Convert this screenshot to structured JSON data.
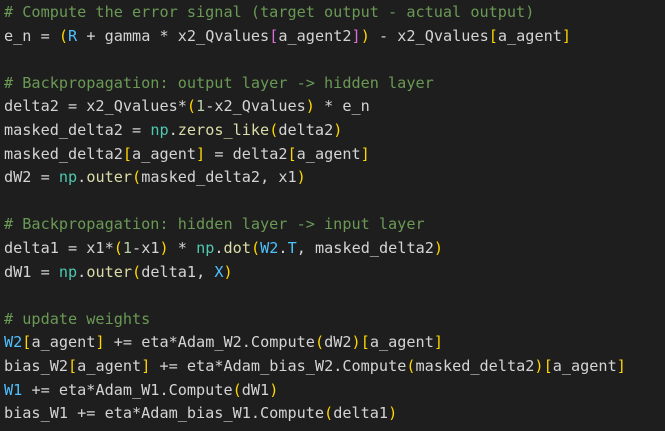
{
  "editor": {
    "lines": [
      [
        [
          "comment",
          "# Compute the error signal (target output - actual output)"
        ]
      ],
      [
        [
          "plain",
          "e_n = "
        ],
        [
          "paren",
          "("
        ],
        [
          "const",
          "R"
        ],
        [
          "plain",
          " + gamma * x2_Qvalues"
        ],
        [
          "bracket-p",
          "["
        ],
        [
          "plain",
          "a_agent2"
        ],
        [
          "bracket-p",
          "]"
        ],
        [
          "paren",
          ")"
        ],
        [
          "plain",
          " - x2_Qvalues"
        ],
        [
          "bracket-y",
          "["
        ],
        [
          "plain",
          "a_agent"
        ],
        [
          "bracket-y",
          "]"
        ]
      ],
      [],
      [
        [
          "comment",
          "# Backpropagation: output layer -> hidden layer"
        ]
      ],
      [
        [
          "plain",
          "delta2 = x2_Qvalues*"
        ],
        [
          "paren",
          "("
        ],
        [
          "num",
          "1"
        ],
        [
          "plain",
          "-x2_Qvalues"
        ],
        [
          "paren",
          ")"
        ],
        [
          "plain",
          " * e_n"
        ]
      ],
      [
        [
          "plain",
          "masked_delta2 = "
        ],
        [
          "class",
          "np"
        ],
        [
          "plain",
          "."
        ],
        [
          "func",
          "zeros_like"
        ],
        [
          "paren",
          "("
        ],
        [
          "plain",
          "delta2"
        ],
        [
          "paren",
          ")"
        ]
      ],
      [
        [
          "plain",
          "masked_delta2"
        ],
        [
          "bracket-y",
          "["
        ],
        [
          "plain",
          "a_agent"
        ],
        [
          "bracket-y",
          "]"
        ],
        [
          "plain",
          " = delta2"
        ],
        [
          "bracket-y",
          "["
        ],
        [
          "plain",
          "a_agent"
        ],
        [
          "bracket-y",
          "]"
        ]
      ],
      [
        [
          "plain",
          "dW2 = "
        ],
        [
          "class",
          "np"
        ],
        [
          "plain",
          "."
        ],
        [
          "func",
          "outer"
        ],
        [
          "paren",
          "("
        ],
        [
          "plain",
          "masked_delta2, x1"
        ],
        [
          "paren",
          ")"
        ]
      ],
      [],
      [
        [
          "comment",
          "# Backpropagation: hidden layer -> input layer"
        ]
      ],
      [
        [
          "plain",
          "delta1 = x1*"
        ],
        [
          "paren",
          "("
        ],
        [
          "num",
          "1"
        ],
        [
          "plain",
          "-x1"
        ],
        [
          "paren",
          ")"
        ],
        [
          "plain",
          " * "
        ],
        [
          "class",
          "np"
        ],
        [
          "plain",
          "."
        ],
        [
          "func",
          "dot"
        ],
        [
          "paren",
          "("
        ],
        [
          "const",
          "W2"
        ],
        [
          "plain",
          "."
        ],
        [
          "const",
          "T"
        ],
        [
          "plain",
          ", masked_delta2"
        ],
        [
          "paren",
          ")"
        ]
      ],
      [
        [
          "plain",
          "dW1 = "
        ],
        [
          "class",
          "np"
        ],
        [
          "plain",
          "."
        ],
        [
          "func",
          "outer"
        ],
        [
          "paren",
          "("
        ],
        [
          "plain",
          "delta1, "
        ],
        [
          "const",
          "X"
        ],
        [
          "paren",
          ")"
        ]
      ],
      [],
      [
        [
          "comment",
          "# update weights"
        ]
      ],
      [
        [
          "const",
          "W2"
        ],
        [
          "bracket-y",
          "["
        ],
        [
          "plain",
          "a_agent"
        ],
        [
          "bracket-y",
          "]"
        ],
        [
          "plain",
          " += eta*Adam_W2.Compute"
        ],
        [
          "paren",
          "("
        ],
        [
          "plain",
          "dW2"
        ],
        [
          "paren",
          ")"
        ],
        [
          "bracket-y",
          "["
        ],
        [
          "plain",
          "a_agent"
        ],
        [
          "bracket-y",
          "]"
        ]
      ],
      [
        [
          "plain",
          "bias_W2"
        ],
        [
          "bracket-y",
          "["
        ],
        [
          "plain",
          "a_agent"
        ],
        [
          "bracket-y",
          "]"
        ],
        [
          "plain",
          " += eta*Adam_bias_W2.Compute"
        ],
        [
          "paren",
          "("
        ],
        [
          "plain",
          "masked_delta2"
        ],
        [
          "paren",
          ")"
        ],
        [
          "bracket-y",
          "["
        ],
        [
          "plain",
          "a_agent"
        ],
        [
          "bracket-y",
          "]"
        ]
      ],
      [
        [
          "const",
          "W1"
        ],
        [
          "plain",
          " += eta*Adam_W1.Compute"
        ],
        [
          "paren",
          "("
        ],
        [
          "plain",
          "dW1"
        ],
        [
          "paren",
          ")"
        ]
      ],
      [
        [
          "plain",
          "bias_W1 += eta*Adam_bias_W1.Compute"
        ],
        [
          "paren",
          "("
        ],
        [
          "plain",
          "delta1"
        ],
        [
          "paren",
          ")"
        ]
      ]
    ]
  }
}
